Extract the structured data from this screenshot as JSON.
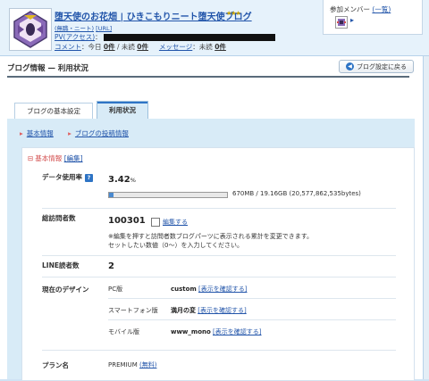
{
  "header": {
    "blog_title": "堕天使のお花畑 | ひきこもりニート堕天使ブログ",
    "stars": "★★★",
    "genre": "(無職・ニート)",
    "url_label": "[URL]",
    "pv_label": "PV(アクセス)",
    "pv_sep": "：",
    "comment_label": "コメント",
    "comment_stats": "：今日",
    "comment_today": "0件",
    "comment_unread_label": " / 未読",
    "comment_unread": "0件",
    "message_label": "メッセージ",
    "message_unread_label": "：未読",
    "message_unread": "0件"
  },
  "members": {
    "title": "参加メンバー",
    "list_link": "(一覧)"
  },
  "page": {
    "section_title": "ブログ情報 — 利用状況",
    "back_button": "ブログ設定に戻る",
    "tabs": [
      "ブログの基本設定",
      "利用状況"
    ],
    "subnav": [
      "基本情報",
      "ブログの投稿情報"
    ]
  },
  "info": {
    "heading": "基本情報",
    "edit": "[編集]",
    "data_usage_label": "データ使用率",
    "usage_percent": "3.42",
    "usage_percent_unit": "%",
    "usage_fraction": 0.0342,
    "usage_text": "670MB / 19.16GB (20,577,862,535bytes)",
    "visitors_label": "総訪問者数",
    "visitors_value": "100301",
    "edit_button": "編集する",
    "note_line1": "※編集を押すと訪問者数ブログパーツに表示される累計を変更できます。",
    "note_line2": "セットしたい数値（0〜）を入力してください。",
    "line_label": "LINE読者数",
    "line_value": "2",
    "design_label": "現在のデザイン",
    "designs": [
      {
        "device": "PC版",
        "theme": "custom",
        "link": "[表示を確認する]"
      },
      {
        "device": "スマートフォン版",
        "theme": "満月の変",
        "link": "[表示を確認する]"
      },
      {
        "device": "モバイル版",
        "theme": "www_mono",
        "link": "[表示を確認する]"
      }
    ],
    "plan_label": "プラン名",
    "plan_value": "PREMIUM",
    "plan_link": "(無料)"
  },
  "colors": {
    "link": "#2255aa",
    "accent": "#2e74c5",
    "panel": "#d8ebf7",
    "header_bg": "#e6f2fb"
  }
}
